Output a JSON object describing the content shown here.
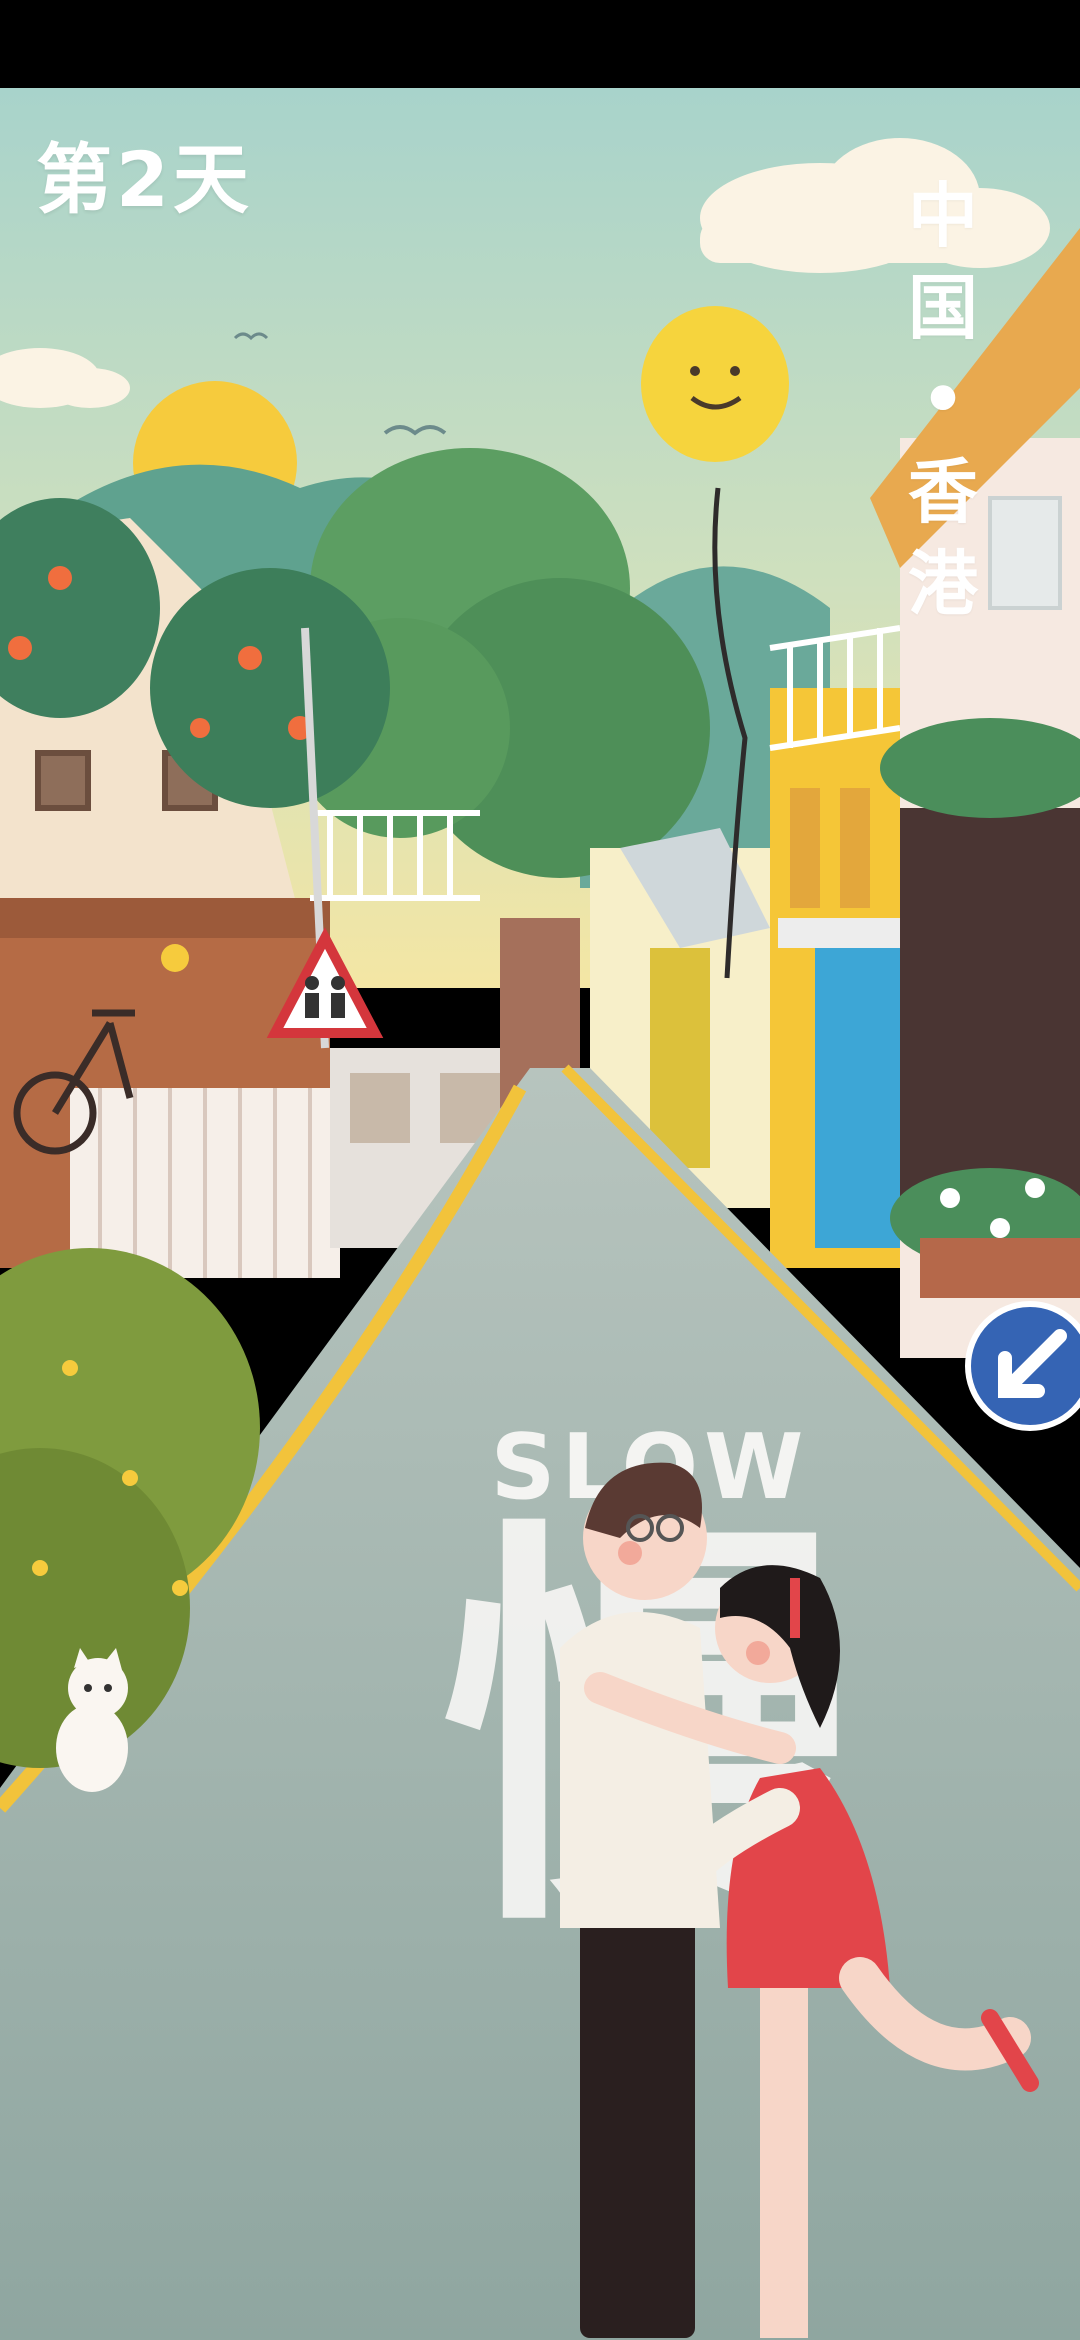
{
  "header": {
    "day_label": "第2天",
    "location_chars": [
      "中",
      "国",
      "•",
      "香",
      "港"
    ]
  },
  "scene": {
    "road_text_en": "SLOW",
    "road_text_cn": "慢",
    "sky_color": "#A9D3CC",
    "road_color": "#A8B8B3",
    "accent_yellow": "#F5C637",
    "dress_red": "#E2454A"
  }
}
